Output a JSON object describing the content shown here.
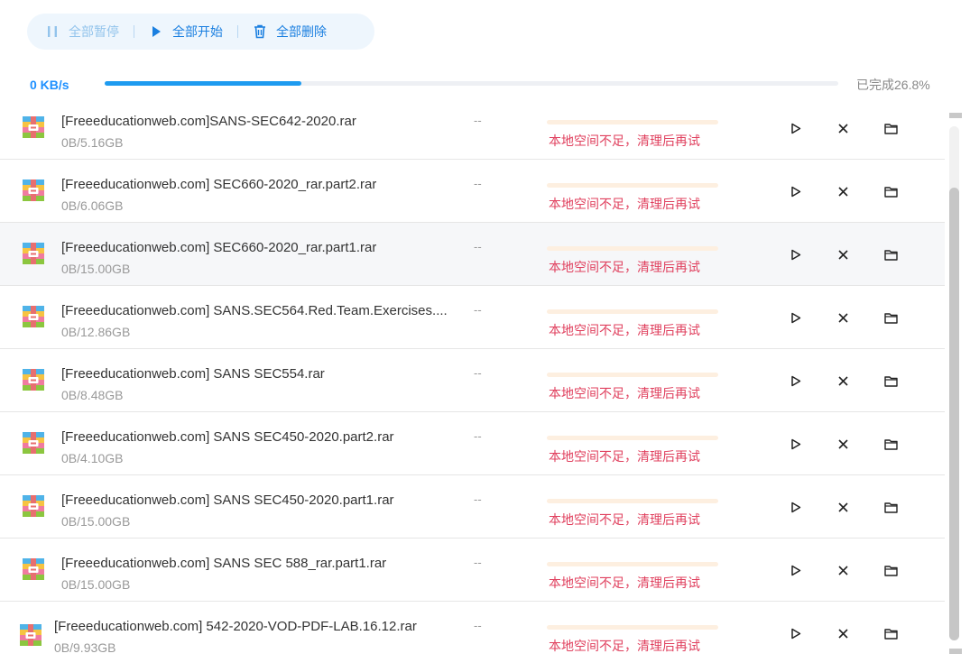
{
  "toolbar": {
    "pause_all": "全部暂停",
    "start_all": "全部开始",
    "delete_all": "全部删除"
  },
  "progress": {
    "speed": "0 KB/s",
    "completed_label": "已完成26.8%",
    "percent": 26.8
  },
  "colors": {
    "accent": "#1a7fe0",
    "error": "#e0405e",
    "progress_fill": "#1e9bf0"
  },
  "downloads": [
    {
      "name": "[Freeeducationweb.com]SANS-SEC642-2020.rar",
      "size": "0B/5.16GB",
      "speed": "--",
      "status": "本地空间不足，清理后再试"
    },
    {
      "name": "[Freeeducationweb.com] SEC660-2020_rar.part2.rar",
      "size": "0B/6.06GB",
      "speed": "--",
      "status": "本地空间不足，清理后再试"
    },
    {
      "name": "[Freeeducationweb.com] SEC660-2020_rar.part1.rar",
      "size": "0B/15.00GB",
      "speed": "--",
      "status": "本地空间不足，清理后再试"
    },
    {
      "name": "[Freeeducationweb.com] SANS.SEC564.Red.Team.Exercises....",
      "size": "0B/12.86GB",
      "speed": "--",
      "status": "本地空间不足，清理后再试"
    },
    {
      "name": "[Freeeducationweb.com] SANS SEC554.rar",
      "size": "0B/8.48GB",
      "speed": "--",
      "status": "本地空间不足，清理后再试"
    },
    {
      "name": "[Freeeducationweb.com] SANS SEC450-2020.part2.rar",
      "size": "0B/4.10GB",
      "speed": "--",
      "status": "本地空间不足，清理后再试"
    },
    {
      "name": "[Freeeducationweb.com] SANS SEC450-2020.part1.rar",
      "size": "0B/15.00GB",
      "speed": "--",
      "status": "本地空间不足，清理后再试"
    },
    {
      "name": "[Freeeducationweb.com] SANS SEC 588_rar.part1.rar",
      "size": "0B/15.00GB",
      "speed": "--",
      "status": "本地空间不足，清理后再试"
    },
    {
      "name": "[Freeeducationweb.com] 542-2020-VOD-PDF-LAB.16.12.rar",
      "size": "0B/9.93GB",
      "speed": "--",
      "status": "本地空间不足，清理后再试"
    }
  ]
}
